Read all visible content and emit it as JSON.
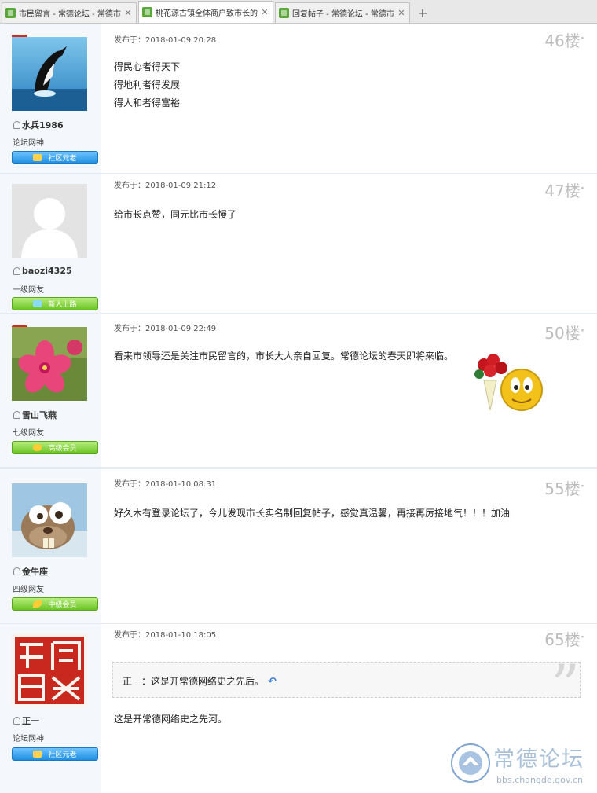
{
  "tabs": [
    {
      "title": "市民留言 - 常德论坛 - 常德市",
      "active": false
    },
    {
      "title": "桃花源古镇全体商户致市长的一封",
      "active": true
    },
    {
      "title": "回复帖子 - 常德论坛 - 常德市",
      "active": false
    }
  ],
  "new_tab_label": "+",
  "posts": [
    {
      "username": "水兵1986",
      "level": "论坛网神",
      "medal": "社区元老",
      "time": "发布于：2018-01-09 20:28",
      "floor": "46楼",
      "lines": [
        "得民心者得天下",
        "得地利者得发展",
        "得人和者得富裕"
      ]
    },
    {
      "username": "baozi4325",
      "level": "一级网友",
      "medal": "新人上路",
      "time": "发布于：2018-01-09 21:12",
      "floor": "47楼",
      "lines": [
        "给市长点赞，同元比市长慢了"
      ]
    },
    {
      "username": "雪山飞燕",
      "level": "七级网友",
      "medal": "高级会员",
      "time": "发布于：2018-01-09 22:49",
      "floor": "50楼",
      "lines": [
        "看来市领导还是关注市民留言的，市长大人亲自回复。常德论坛的春天即将来临。"
      ]
    },
    {
      "username": "金牛座",
      "level": "四级网友",
      "medal": "中级会员",
      "time": "发布于：2018-01-10 08:31",
      "floor": "55楼",
      "lines": [
        "好久木有登录论坛了，今儿发现市长实名制回复帖子，感觉真温馨，再接再厉接地气！！！加油"
      ]
    },
    {
      "username": "正一",
      "level": "论坛网神",
      "medal": "社区元老",
      "time": "发布于：2018-01-10 18:05",
      "floor": "65楼",
      "quote": "正一：这是开常德网络史之先后。",
      "lines": [
        "这是开常德网络史之先河。"
      ]
    }
  ],
  "watermark": {
    "title": "常德论坛",
    "url": "bbs.changde.gov.cn"
  },
  "colors": {
    "medal_blue": "#1f8fe0",
    "medal_green": "#69c322",
    "online_badge": "#d42b20",
    "sidebar_bg": "#f4f7fb"
  }
}
